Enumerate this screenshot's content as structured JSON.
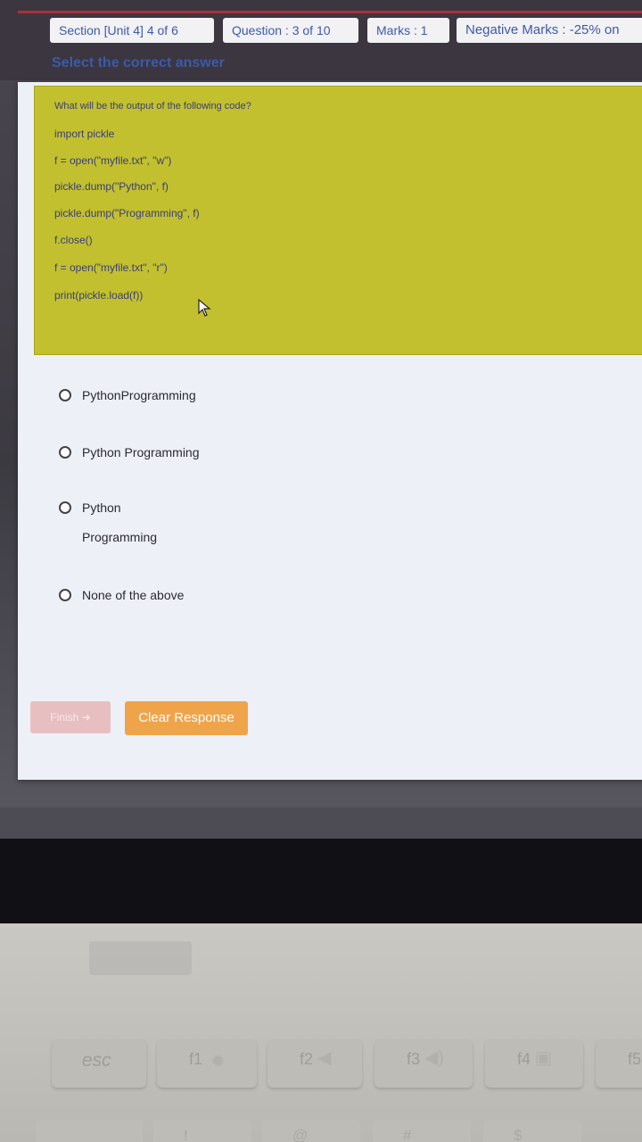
{
  "header": {
    "section": "Section [Unit 4] 4 of 6",
    "question": "Question : 3 of 10",
    "marks": "Marks : 1",
    "negative": "Negative Marks : -25% on"
  },
  "instruction": "Select the correct answer",
  "question": {
    "prompt": "What will be the output of the following code?",
    "code": [
      "import pickle",
      "f = open(\"myfile.txt\", \"w\")",
      "pickle.dump(\"Python\", f)",
      "pickle.dump(\"Programming\", f)",
      "f.close()",
      "f = open(\"myfile.txt\", \"r\")",
      "print(pickle.load(f))"
    ]
  },
  "options": [
    {
      "label": "PythonProgramming"
    },
    {
      "label": "Python Programming"
    },
    {
      "label_line1": "Python",
      "label_line2": "Programming"
    },
    {
      "label": "None of the above"
    }
  ],
  "buttons": {
    "finish": "Finish",
    "clear": "Clear Response"
  },
  "keyboard": {
    "esc": "esc",
    "f1": "f1",
    "f2": "f2",
    "f3": "f3",
    "f4": "f4",
    "f5": "f5",
    "row2_b": "!",
    "row2_c": "@",
    "row2_d": "#",
    "row2_e": "$"
  },
  "icons": {
    "cursor": "mouse-pointer-icon",
    "finish": "arrow-right-icon"
  },
  "colors": {
    "question_bg": "#c2c02e",
    "clear_button": "#f0a44a",
    "finish_button": "#e7bfc1",
    "header_text": "#3d5aa8"
  }
}
